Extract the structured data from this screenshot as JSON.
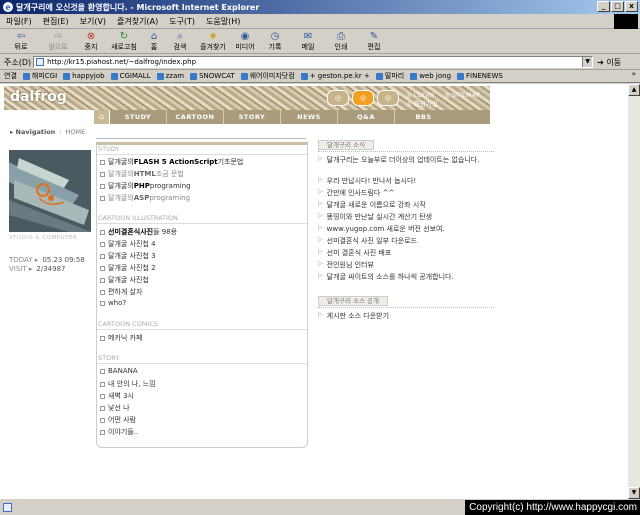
{
  "window": {
    "title": "달개구리에 오신것을 환영합니다. - Microsoft Internet Explorer",
    "controls": [
      "_",
      "□",
      "x"
    ]
  },
  "menu": [
    "파일(F)",
    "편집(E)",
    "보기(V)",
    "즐겨찾기(A)",
    "도구(T)",
    "도움말(H)"
  ],
  "toolbar": [
    {
      "label": "뒤로",
      "icon": "back-icon",
      "enabled": true
    },
    {
      "label": "앞으로",
      "icon": "forward-icon",
      "enabled": false
    },
    {
      "label": "중지",
      "icon": "stop-icon",
      "enabled": true
    },
    {
      "label": "새로고침",
      "icon": "refresh-icon",
      "enabled": true
    },
    {
      "label": "홈",
      "icon": "home-icon",
      "enabled": true
    },
    {
      "label": "검색",
      "icon": "search-icon",
      "enabled": true
    },
    {
      "label": "즐겨찾기",
      "icon": "favorites-icon",
      "enabled": true
    },
    {
      "label": "미디어",
      "icon": "media-icon",
      "enabled": true
    },
    {
      "label": "기록",
      "icon": "history-icon",
      "enabled": true
    },
    {
      "label": "메일",
      "icon": "mail-icon",
      "enabled": true
    },
    {
      "label": "인쇄",
      "icon": "print-icon",
      "enabled": true
    },
    {
      "label": "편집",
      "icon": "edit-icon",
      "enabled": true
    }
  ],
  "address": {
    "label": "주소(D)",
    "url": "http://kr15.piahost.net/~dalfrog/index.php",
    "go_label": "이동"
  },
  "links": {
    "label": "연결",
    "items": [
      "해피CGI",
      "happyjob",
      "CGIMALL",
      "zzam",
      "SNOWCAT",
      "웨어이미지닷컴",
      "+ geston.pe.kr +",
      "딸마리",
      "web jong",
      "FINENEWS"
    ],
    "more": "»"
  },
  "site": {
    "logo": "dalfrog",
    "header_icons": [
      "◎",
      "◎",
      "◎"
    ],
    "login": "LOGIN",
    "sitemap": "SITEMAP",
    "join": "회원가입",
    "nav": [
      "STUDY",
      "CARTOON",
      "STORY",
      "NEWS",
      "Q&A",
      "BBS"
    ],
    "breadcrumb": {
      "label": "Navigation",
      "sep": ":",
      "current": "HOME"
    },
    "image_caption": "STUDIO & COMPUTER",
    "stats": [
      {
        "key": "TODAY",
        "value": "05.23 09:58"
      },
      {
        "key": "VISIT",
        "value": "2/34987"
      }
    ]
  },
  "sections": [
    {
      "title": "STUDY",
      "items": [
        {
          "pre": "달개굴의 ",
          "bold": "FLASH 5 ActionScript",
          "post": " 기초문법",
          "light": false
        },
        {
          "pre": "달개굴의 ",
          "bold": "HTML",
          "post": " 조금 문법",
          "light": true
        },
        {
          "pre": "달개굴의 ",
          "bold": "PHP",
          "post": " programing",
          "light": false
        },
        {
          "pre": "달개굴의 ",
          "bold": "ASP",
          "post": " programing",
          "light": true
        }
      ]
    },
    {
      "title": "CARTOON  ILLUSTRATION",
      "items": [
        {
          "pre": "",
          "bold": "선미결혼식사진",
          "post": "들 98용",
          "light": false
        },
        {
          "pre": "달개굴 사진첩 4",
          "bold": "",
          "post": "",
          "light": false
        },
        {
          "pre": "달개굴 사진첩 3",
          "bold": "",
          "post": "",
          "light": false
        },
        {
          "pre": "달개굴 사진첩 2",
          "bold": "",
          "post": "",
          "light": false
        },
        {
          "pre": "달개굴 사진첩",
          "bold": "",
          "post": "",
          "light": false
        },
        {
          "pre": "편하게 살자",
          "bold": "",
          "post": "",
          "light": false
        },
        {
          "pre": "who?",
          "bold": "",
          "post": "",
          "light": false
        }
      ]
    },
    {
      "title": "CARTOON  COMICS",
      "items": [
        {
          "pre": "메카닉 카페",
          "bold": "",
          "post": "",
          "light": false
        }
      ]
    },
    {
      "title": "STORY",
      "items": [
        {
          "pre": "BANANA",
          "bold": "",
          "post": "",
          "light": false
        },
        {
          "pre": "내 안의 나, 느낌",
          "bold": "",
          "post": "",
          "light": false
        },
        {
          "pre": "새벽 3시",
          "bold": "",
          "post": "",
          "light": false
        },
        {
          "pre": "낯선 나",
          "bold": "",
          "post": "",
          "light": false
        },
        {
          "pre": "어떤 사람",
          "bold": "",
          "post": "",
          "light": false
        },
        {
          "pre": "이야기들..",
          "bold": "",
          "post": "",
          "light": false
        }
      ]
    }
  ],
  "news": {
    "title": "달개구리 소식",
    "items": [
      "달개구리는 오늘부로 더이상의 업데이트는 없습니다.",
      "우리 만납시다! 만나서 놉시다!",
      "간만에 인사드림다 ^^",
      "달개굴 새로운 이름으로 강좌 시작",
      "똥띵이와 만난날 실시간 계산기 탄생",
      "www.yugop.com 새로운 버전 선보여.",
      "선미결혼식 사진 일부 다운로드",
      "선미 결혼식 사진 배포",
      "전인원님 인터뷰",
      "달개굴 싸이트의 소스를 하나씩 공개합니다."
    ],
    "source_title": "달개구리 소스 공개",
    "source_items": [
      "게시판 소스 다운받기"
    ]
  },
  "copyright": "Copyright(c) http://www.happycgi.com",
  "colors": {
    "title_bar": "#0a246a",
    "nav_bg": "#a89c7c",
    "accent": "#f0a020"
  }
}
